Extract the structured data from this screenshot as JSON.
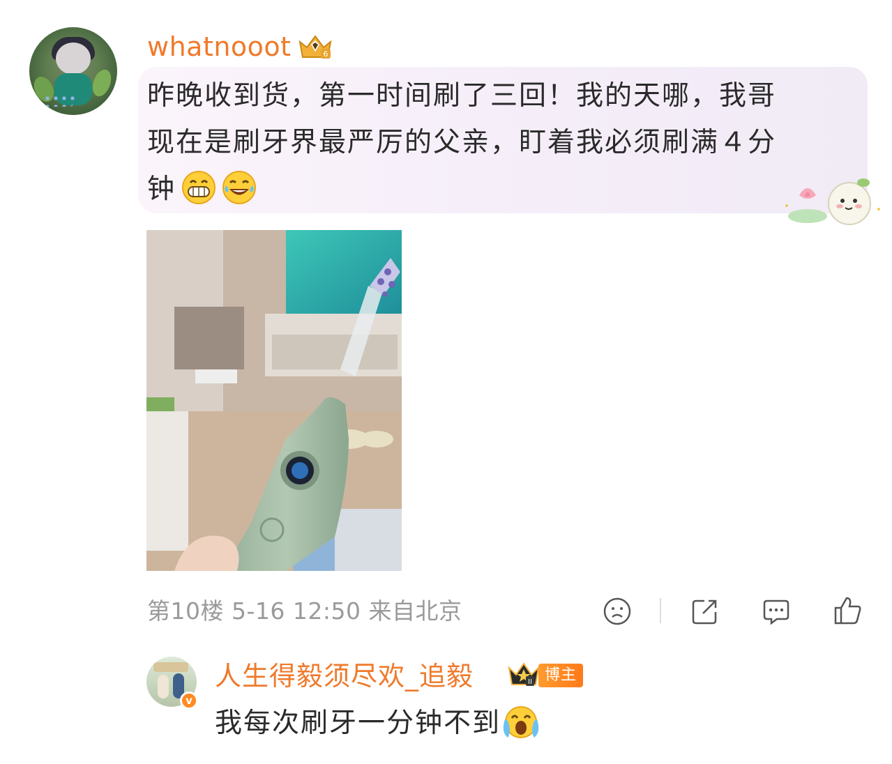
{
  "comment": {
    "username": "whatnooot",
    "user_badge_icon": "gold-crown-level-badge",
    "text_line1": "昨晚收到货，第一时间刷了三回！我的天哪，我哥",
    "text_line2": "现在是刷牙界最严厉的父亲，盯着我必须刷满４分",
    "text_line3": "钟",
    "emojis": [
      "grinning-face-emoji",
      "laughing-tears-emoji"
    ],
    "image": "photo of a green electric toothbrush with a round display",
    "floor": "第10楼",
    "date": "5-16 12:50",
    "location": "来自北京",
    "actions": [
      "sad-face-icon",
      "share-icon",
      "comment-icon",
      "like-icon"
    ]
  },
  "reply": {
    "username": "人生得毅须尽欢_追毅",
    "crown_icon": "black-crown-level-badge",
    "host_badge": "博主",
    "verified_icon": "verified-v-badge",
    "text": "我每次刷牙一分钟不到",
    "emoji": "crying-face-emoji"
  },
  "colors": {
    "username": "#ef7a2c",
    "text": "#2a2a2a",
    "meta": "#9a9a9a",
    "bubble_bg": "#f7f0fa"
  }
}
